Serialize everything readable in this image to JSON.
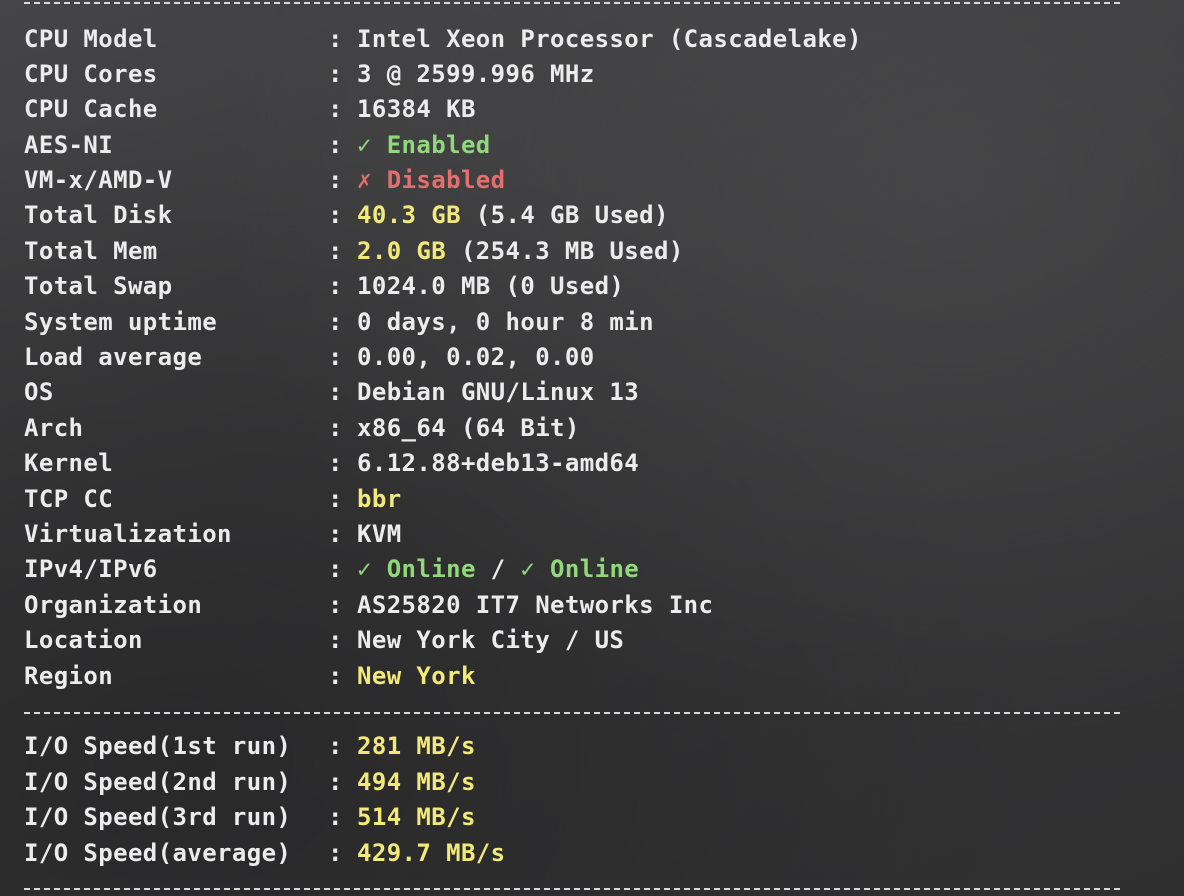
{
  "colors": {
    "background": "#3b3b3c",
    "text": "#ececec",
    "yellow": "#f2e97a",
    "green": "#8fd97a",
    "red": "#e36f6f"
  },
  "colon": ":",
  "sysinfo": {
    "cpu_model": {
      "label": "CPU Model",
      "value": "Intel Xeon Processor (Cascadelake)"
    },
    "cpu_cores": {
      "label": "CPU Cores",
      "value": "3 @ 2599.996 MHz"
    },
    "cpu_cache": {
      "label": "CPU Cache",
      "value": "16384 KB"
    },
    "aes_ni": {
      "label": "AES-NI",
      "value": "✓ Enabled"
    },
    "vm_x": {
      "label": "VM-x/AMD-V",
      "value": "✗ Disabled"
    },
    "total_disk": {
      "label": "Total Disk",
      "value": "40.3 GB",
      "extra": " (5.4 GB Used)"
    },
    "total_mem": {
      "label": "Total Mem",
      "value": "2.0 GB",
      "extra": " (254.3 MB Used)"
    },
    "total_swap": {
      "label": "Total Swap",
      "value": "1024.0 MB (0 Used)"
    },
    "uptime": {
      "label": "System uptime",
      "value": "0 days, 0 hour 8 min"
    },
    "load": {
      "label": "Load average",
      "value": "0.00, 0.02, 0.00"
    },
    "os": {
      "label": "OS",
      "value": "Debian GNU/Linux 13"
    },
    "arch": {
      "label": "Arch",
      "value": "x86_64 (64 Bit)"
    },
    "kernel": {
      "label": "Kernel",
      "value": "6.12.88+deb13-amd64"
    },
    "tcp_cc": {
      "label": "TCP CC",
      "value": "bbr"
    },
    "virtualization": {
      "label": "Virtualization",
      "value": "KVM"
    },
    "ip": {
      "label": "IPv4/IPv6",
      "v4": "✓ Online",
      "slash": " / ",
      "v6": "✓ Online"
    },
    "organization": {
      "label": "Organization",
      "value": "AS25820 IT7 Networks Inc"
    },
    "location": {
      "label": "Location",
      "value": "New York City / US"
    },
    "region": {
      "label": "Region",
      "value": "New York"
    }
  },
  "io": {
    "run1": {
      "label": "I/O Speed(1st run)",
      "value": "281 MB/s"
    },
    "run2": {
      "label": "I/O Speed(2nd run)",
      "value": "494 MB/s"
    },
    "run3": {
      "label": "I/O Speed(3rd run)",
      "value": "514 MB/s"
    },
    "average": {
      "label": "I/O Speed(average)",
      "value": "429.7 MB/s"
    }
  }
}
